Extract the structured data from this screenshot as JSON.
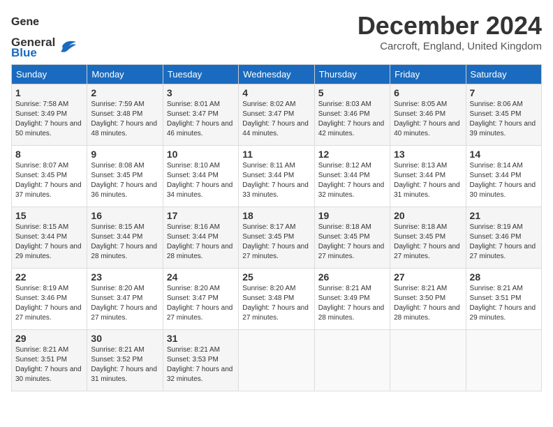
{
  "logo": {
    "line1": "General",
    "line2": "Blue"
  },
  "title": "December 2024",
  "location": "Carcroft, England, United Kingdom",
  "weekdays": [
    "Sunday",
    "Monday",
    "Tuesday",
    "Wednesday",
    "Thursday",
    "Friday",
    "Saturday"
  ],
  "weeks": [
    [
      {
        "day": "1",
        "sunrise": "Sunrise: 7:58 AM",
        "sunset": "Sunset: 3:49 PM",
        "daylight": "Daylight: 7 hours and 50 minutes."
      },
      {
        "day": "2",
        "sunrise": "Sunrise: 7:59 AM",
        "sunset": "Sunset: 3:48 PM",
        "daylight": "Daylight: 7 hours and 48 minutes."
      },
      {
        "day": "3",
        "sunrise": "Sunrise: 8:01 AM",
        "sunset": "Sunset: 3:47 PM",
        "daylight": "Daylight: 7 hours and 46 minutes."
      },
      {
        "day": "4",
        "sunrise": "Sunrise: 8:02 AM",
        "sunset": "Sunset: 3:47 PM",
        "daylight": "Daylight: 7 hours and 44 minutes."
      },
      {
        "day": "5",
        "sunrise": "Sunrise: 8:03 AM",
        "sunset": "Sunset: 3:46 PM",
        "daylight": "Daylight: 7 hours and 42 minutes."
      },
      {
        "day": "6",
        "sunrise": "Sunrise: 8:05 AM",
        "sunset": "Sunset: 3:46 PM",
        "daylight": "Daylight: 7 hours and 40 minutes."
      },
      {
        "day": "7",
        "sunrise": "Sunrise: 8:06 AM",
        "sunset": "Sunset: 3:45 PM",
        "daylight": "Daylight: 7 hours and 39 minutes."
      }
    ],
    [
      {
        "day": "8",
        "sunrise": "Sunrise: 8:07 AM",
        "sunset": "Sunset: 3:45 PM",
        "daylight": "Daylight: 7 hours and 37 minutes."
      },
      {
        "day": "9",
        "sunrise": "Sunrise: 8:08 AM",
        "sunset": "Sunset: 3:45 PM",
        "daylight": "Daylight: 7 hours and 36 minutes."
      },
      {
        "day": "10",
        "sunrise": "Sunrise: 8:10 AM",
        "sunset": "Sunset: 3:44 PM",
        "daylight": "Daylight: 7 hours and 34 minutes."
      },
      {
        "day": "11",
        "sunrise": "Sunrise: 8:11 AM",
        "sunset": "Sunset: 3:44 PM",
        "daylight": "Daylight: 7 hours and 33 minutes."
      },
      {
        "day": "12",
        "sunrise": "Sunrise: 8:12 AM",
        "sunset": "Sunset: 3:44 PM",
        "daylight": "Daylight: 7 hours and 32 minutes."
      },
      {
        "day": "13",
        "sunrise": "Sunrise: 8:13 AM",
        "sunset": "Sunset: 3:44 PM",
        "daylight": "Daylight: 7 hours and 31 minutes."
      },
      {
        "day": "14",
        "sunrise": "Sunrise: 8:14 AM",
        "sunset": "Sunset: 3:44 PM",
        "daylight": "Daylight: 7 hours and 30 minutes."
      }
    ],
    [
      {
        "day": "15",
        "sunrise": "Sunrise: 8:15 AM",
        "sunset": "Sunset: 3:44 PM",
        "daylight": "Daylight: 7 hours and 29 minutes."
      },
      {
        "day": "16",
        "sunrise": "Sunrise: 8:15 AM",
        "sunset": "Sunset: 3:44 PM",
        "daylight": "Daylight: 7 hours and 28 minutes."
      },
      {
        "day": "17",
        "sunrise": "Sunrise: 8:16 AM",
        "sunset": "Sunset: 3:44 PM",
        "daylight": "Daylight: 7 hours and 28 minutes."
      },
      {
        "day": "18",
        "sunrise": "Sunrise: 8:17 AM",
        "sunset": "Sunset: 3:45 PM",
        "daylight": "Daylight: 7 hours and 27 minutes."
      },
      {
        "day": "19",
        "sunrise": "Sunrise: 8:18 AM",
        "sunset": "Sunset: 3:45 PM",
        "daylight": "Daylight: 7 hours and 27 minutes."
      },
      {
        "day": "20",
        "sunrise": "Sunrise: 8:18 AM",
        "sunset": "Sunset: 3:45 PM",
        "daylight": "Daylight: 7 hours and 27 minutes."
      },
      {
        "day": "21",
        "sunrise": "Sunrise: 8:19 AM",
        "sunset": "Sunset: 3:46 PM",
        "daylight": "Daylight: 7 hours and 27 minutes."
      }
    ],
    [
      {
        "day": "22",
        "sunrise": "Sunrise: 8:19 AM",
        "sunset": "Sunset: 3:46 PM",
        "daylight": "Daylight: 7 hours and 27 minutes."
      },
      {
        "day": "23",
        "sunrise": "Sunrise: 8:20 AM",
        "sunset": "Sunset: 3:47 PM",
        "daylight": "Daylight: 7 hours and 27 minutes."
      },
      {
        "day": "24",
        "sunrise": "Sunrise: 8:20 AM",
        "sunset": "Sunset: 3:47 PM",
        "daylight": "Daylight: 7 hours and 27 minutes."
      },
      {
        "day": "25",
        "sunrise": "Sunrise: 8:20 AM",
        "sunset": "Sunset: 3:48 PM",
        "daylight": "Daylight: 7 hours and 27 minutes."
      },
      {
        "day": "26",
        "sunrise": "Sunrise: 8:21 AM",
        "sunset": "Sunset: 3:49 PM",
        "daylight": "Daylight: 7 hours and 28 minutes."
      },
      {
        "day": "27",
        "sunrise": "Sunrise: 8:21 AM",
        "sunset": "Sunset: 3:50 PM",
        "daylight": "Daylight: 7 hours and 28 minutes."
      },
      {
        "day": "28",
        "sunrise": "Sunrise: 8:21 AM",
        "sunset": "Sunset: 3:51 PM",
        "daylight": "Daylight: 7 hours and 29 minutes."
      }
    ],
    [
      {
        "day": "29",
        "sunrise": "Sunrise: 8:21 AM",
        "sunset": "Sunset: 3:51 PM",
        "daylight": "Daylight: 7 hours and 30 minutes."
      },
      {
        "day": "30",
        "sunrise": "Sunrise: 8:21 AM",
        "sunset": "Sunset: 3:52 PM",
        "daylight": "Daylight: 7 hours and 31 minutes."
      },
      {
        "day": "31",
        "sunrise": "Sunrise: 8:21 AM",
        "sunset": "Sunset: 3:53 PM",
        "daylight": "Daylight: 7 hours and 32 minutes."
      },
      null,
      null,
      null,
      null
    ]
  ]
}
